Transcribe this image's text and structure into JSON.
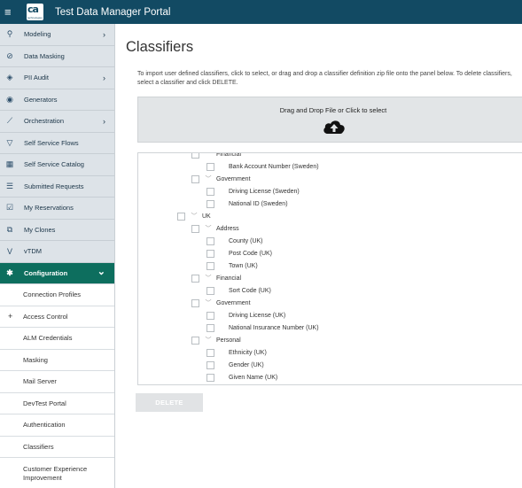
{
  "app": {
    "title": "Test Data Manager Portal",
    "logo_text": "ca",
    "logo_subtext": "technologies",
    "menu_glyph": "≡"
  },
  "sidebar": {
    "items": [
      {
        "label": "Modeling",
        "icon": "modeling-icon",
        "chevron": true
      },
      {
        "label": "Data Masking",
        "icon": "mask-icon",
        "chevron": false
      },
      {
        "label": "PII Audit",
        "icon": "audit-icon",
        "chevron": true
      },
      {
        "label": "Generators",
        "icon": "generator-icon",
        "chevron": false
      },
      {
        "label": "Orchestration",
        "icon": "orchestration-icon",
        "chevron": true
      },
      {
        "label": "Self Service Flows",
        "icon": "flows-icon",
        "chevron": false
      },
      {
        "label": "Self Service Catalog",
        "icon": "catalog-icon",
        "chevron": false
      },
      {
        "label": "Submitted Requests",
        "icon": "requests-icon",
        "chevron": false
      },
      {
        "label": "My Reservations",
        "icon": "reservations-icon",
        "chevron": false
      },
      {
        "label": "My Clones",
        "icon": "clones-icon",
        "chevron": false
      },
      {
        "label": "vTDM",
        "icon": "vtdm-icon",
        "chevron": false
      },
      {
        "label": "Configuration",
        "icon": "gear-icon",
        "chevron": true,
        "active": true
      }
    ],
    "sub_items": [
      {
        "label": "Connection Profiles"
      },
      {
        "label": "Access Control",
        "plus": true
      },
      {
        "label": "ALM Credentials"
      },
      {
        "label": "Masking"
      },
      {
        "label": "Mail Server"
      },
      {
        "label": "DevTest Portal"
      },
      {
        "label": "Authentication"
      },
      {
        "label": "Classifiers"
      },
      {
        "label": "Customer Experience Improvement"
      }
    ]
  },
  "main": {
    "title": "Classifiers",
    "instructions": "To import user defined classifiers, click to select, or drag and drop a classifier definition zip file onto the panel below. To delete classifiers, select a classifier and click DELETE.",
    "dropzone_label": "Drag and Drop File or Click to select",
    "delete_label": "DELETE"
  },
  "tree": [
    {
      "label": "Financial",
      "level": 2,
      "toggle": true,
      "partial": true
    },
    {
      "label": "Bank Account Number (Sweden)",
      "level": 3
    },
    {
      "label": "Government",
      "level": 2,
      "toggle": true
    },
    {
      "label": "Driving License (Sweden)",
      "level": 3
    },
    {
      "label": "National ID (Sweden)",
      "level": 3
    },
    {
      "label": "UK",
      "level": 1,
      "toggle": true
    },
    {
      "label": "Address",
      "level": 2,
      "toggle": true
    },
    {
      "label": "County (UK)",
      "level": 3
    },
    {
      "label": "Post Code (UK)",
      "level": 3
    },
    {
      "label": "Town (UK)",
      "level": 3
    },
    {
      "label": "Financial",
      "level": 2,
      "toggle": true
    },
    {
      "label": "Sort Code (UK)",
      "level": 3
    },
    {
      "label": "Government",
      "level": 2,
      "toggle": true
    },
    {
      "label": "Driving License (UK)",
      "level": 3
    },
    {
      "label": "National Insurance Number (UK)",
      "level": 3
    },
    {
      "label": "Personal",
      "level": 2,
      "toggle": true
    },
    {
      "label": "Ethnicity (UK)",
      "level": 3
    },
    {
      "label": "Gender (UK)",
      "level": 3
    },
    {
      "label": "Given Name (UK)",
      "level": 3
    }
  ],
  "colors": {
    "topbar": "#124a63",
    "active_nav": "#0d6e5e",
    "nav_bg": "#dde3e8"
  }
}
